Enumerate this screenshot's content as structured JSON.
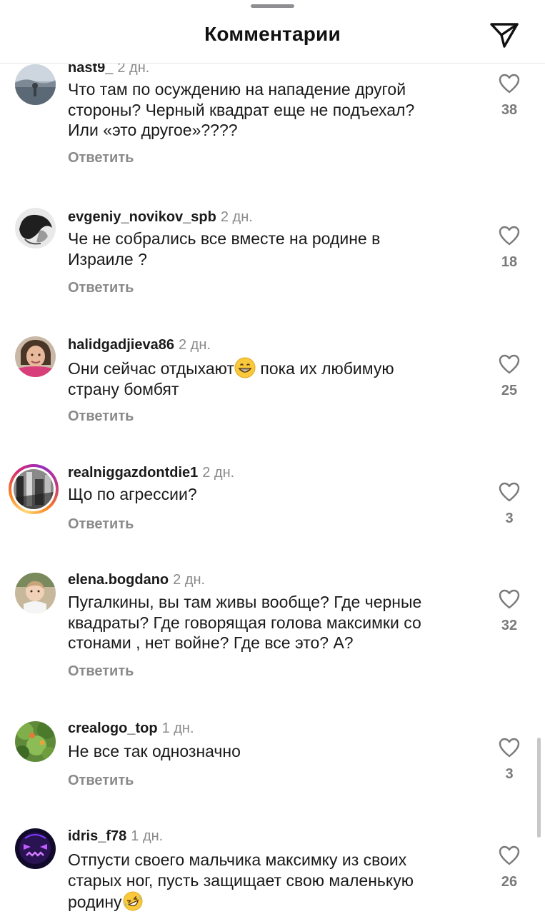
{
  "header": {
    "title": "Комментарии",
    "share_icon": "paper-plane-icon"
  },
  "comments": [
    {
      "username": "nast9_",
      "time": "2 дн.",
      "text": "Что там по осуждению на нападение другой\nстороны? Черный квадрат еще не подъехал?\nИли «это другое»????",
      "reply": "Ответить",
      "likes": "38"
    },
    {
      "username": "evgeniy_novikov_spb",
      "time": "2 дн.",
      "text": "Че не собрались все вместе на родине в\nИзраиле ?",
      "reply": "Ответить",
      "likes": "18"
    },
    {
      "username": "halidgadjieva86",
      "time": "2 дн.",
      "text_before": "Они сейчас отдыхают",
      "emoji": "grinning-face-emoji",
      "text_after": " пока их любимую\nстрану бомбят",
      "reply": "Ответить",
      "likes": "25"
    },
    {
      "username": "realniggazdontdie1",
      "time": "2 дн.",
      "text": "Що по агрессии?",
      "reply": "Ответить",
      "likes": "3"
    },
    {
      "username": "elena.bogdano",
      "time": "2 дн.",
      "text": "Пугалкины, вы там живы вообще? Где черные\nквадраты? Где говорящая голова максимки со\nстонами , нет войне? Где все это? А?",
      "reply": "Ответить",
      "likes": "32"
    },
    {
      "username": "crealogo_top",
      "time": "1 дн.",
      "text": "Не все так однозначно",
      "reply": "Ответить",
      "likes": "3"
    },
    {
      "username": "idris_f78",
      "time": "1 дн.",
      "text_before": "Отпусти своего мальчика максимку из своих\nстарых ног, пусть защищает свою маленькую\nродину",
      "emoji": "rolling-on-the-floor-laughing-emoji",
      "text_after": "",
      "likes": "26"
    }
  ],
  "colors": {
    "primary_text": "#1a1a1a",
    "secondary_text": "#8a8a8a",
    "like_count": "#7a7a7a"
  }
}
